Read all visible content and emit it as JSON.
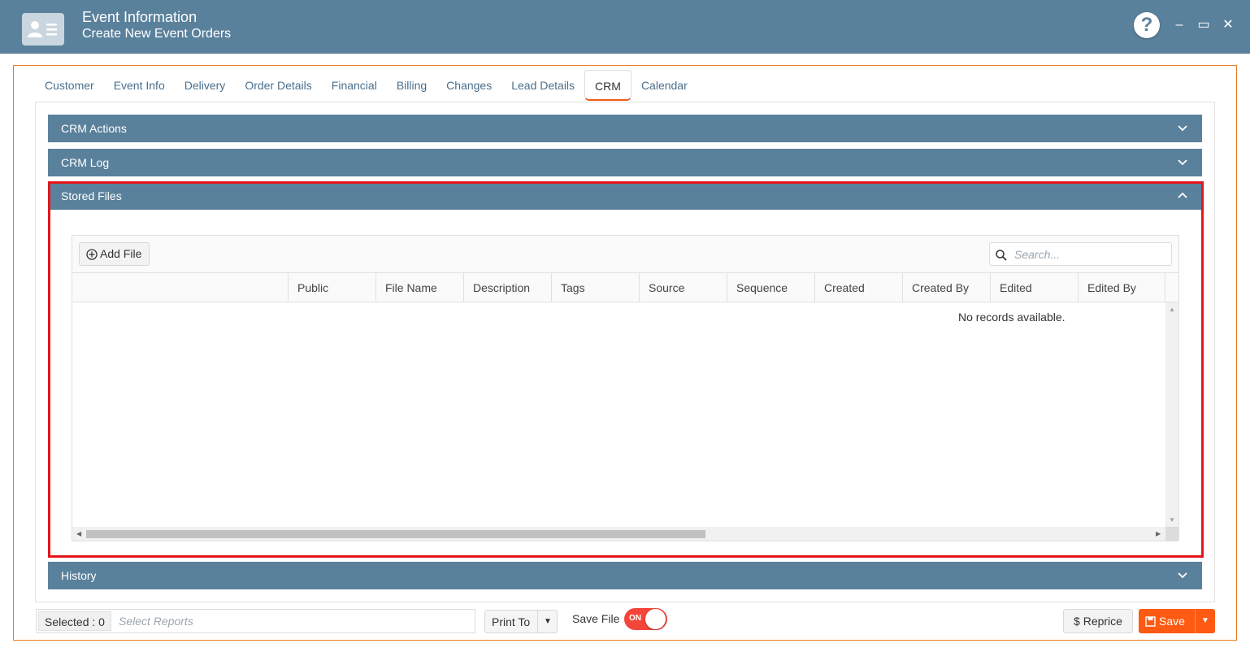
{
  "window": {
    "title": "Event Information",
    "subtitle": "Create New Event Orders",
    "help_label": "?",
    "minimize_label": "–",
    "maximize_label": "▭",
    "close_label": "✕"
  },
  "tabs": [
    {
      "label": "Customer"
    },
    {
      "label": "Event Info"
    },
    {
      "label": "Delivery"
    },
    {
      "label": "Order Details"
    },
    {
      "label": "Financial"
    },
    {
      "label": "Billing"
    },
    {
      "label": "Changes"
    },
    {
      "label": "Lead Details"
    },
    {
      "label": "CRM",
      "active": true
    },
    {
      "label": "Calendar"
    }
  ],
  "panels": {
    "crm_actions": "CRM Actions",
    "crm_log": "CRM Log",
    "stored_files": "Stored Files",
    "history": "History"
  },
  "stored_files": {
    "add_file_label": "Add File",
    "search_placeholder": "Search...",
    "columns": [
      "Public",
      "File Name",
      "Description",
      "Tags",
      "Source",
      "Sequence",
      "Created",
      "Created By",
      "Edited",
      "Edited By"
    ],
    "empty_message": "No records available."
  },
  "footer": {
    "selected_label": "Selected : 0",
    "select_reports_placeholder": "Select Reports",
    "print_to_label": "Print To",
    "save_file_label": "Save File",
    "toggle_state": "ON",
    "reprice_label": "$  Reprice",
    "save_label": "Save"
  },
  "colors": {
    "header_blue": "#5a819c",
    "accent_orange": "#ff5a13",
    "highlight_red": "#e4161b",
    "toggle_red": "#f4453a"
  }
}
